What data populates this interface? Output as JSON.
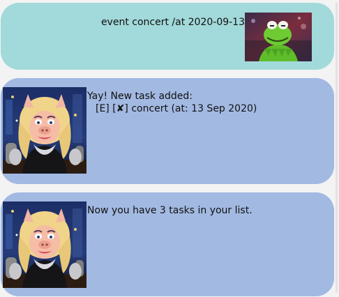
{
  "chat": {
    "user_message": {
      "text": "event concert /at 2020-09-13",
      "avatar_icon": "kermit-frog-avatar"
    },
    "bot_messages": [
      {
        "avatar_icon": "miss-piggy-avatar",
        "line1": "Yay! New task added:",
        "line2": "[E] [✘] concert (at: 13 Sep 2020)"
      },
      {
        "avatar_icon": "miss-piggy-avatar",
        "line1": "Now you have 3 tasks in your list."
      }
    ]
  },
  "colors": {
    "user_bubble": "#a2d9da",
    "bot_bubble": "#a2b9e2",
    "background": "#f3f3f3"
  }
}
